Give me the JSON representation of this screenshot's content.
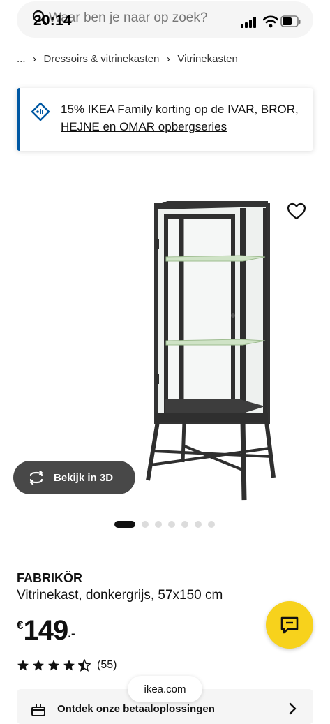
{
  "status": {
    "time": "20:14"
  },
  "search": {
    "placeholder": "Waar ben je naar op zoek?"
  },
  "breadcrumb": {
    "ellipsis": "...",
    "items": [
      "Dressoirs & vitrinekasten",
      "Vitrinekasten"
    ]
  },
  "promo": {
    "text": "15% IKEA Family korting op de IVAR, BROR, HEJNE en OMAR opbergseries"
  },
  "gallery": {
    "view3d_label": "Bekijk in 3D",
    "dot_count": 7,
    "active_dot": 1
  },
  "product": {
    "name": "FABRIKÖR",
    "desc_prefix": "Vitrinekast, donkergrijs, ",
    "size": "57x150 cm",
    "currency": "€",
    "price_int": "149",
    "price_dec": ".-",
    "rating": 4.5,
    "review_count": "(55)"
  },
  "payment": {
    "label": "Ontdek onze betaaloplossingen"
  },
  "browser": {
    "url": "ikea.com"
  },
  "colors": {
    "accent": "#0058a3",
    "chat": "#f7d21c",
    "button_dark": "#484848"
  },
  "icons": [
    "search-icon",
    "signal-icon",
    "wifi-icon",
    "battery-icon",
    "chevron-right-icon",
    "tag-icon",
    "heart-icon",
    "rotate-3d-icon",
    "chat-icon",
    "star-icon",
    "payment-icon"
  ]
}
